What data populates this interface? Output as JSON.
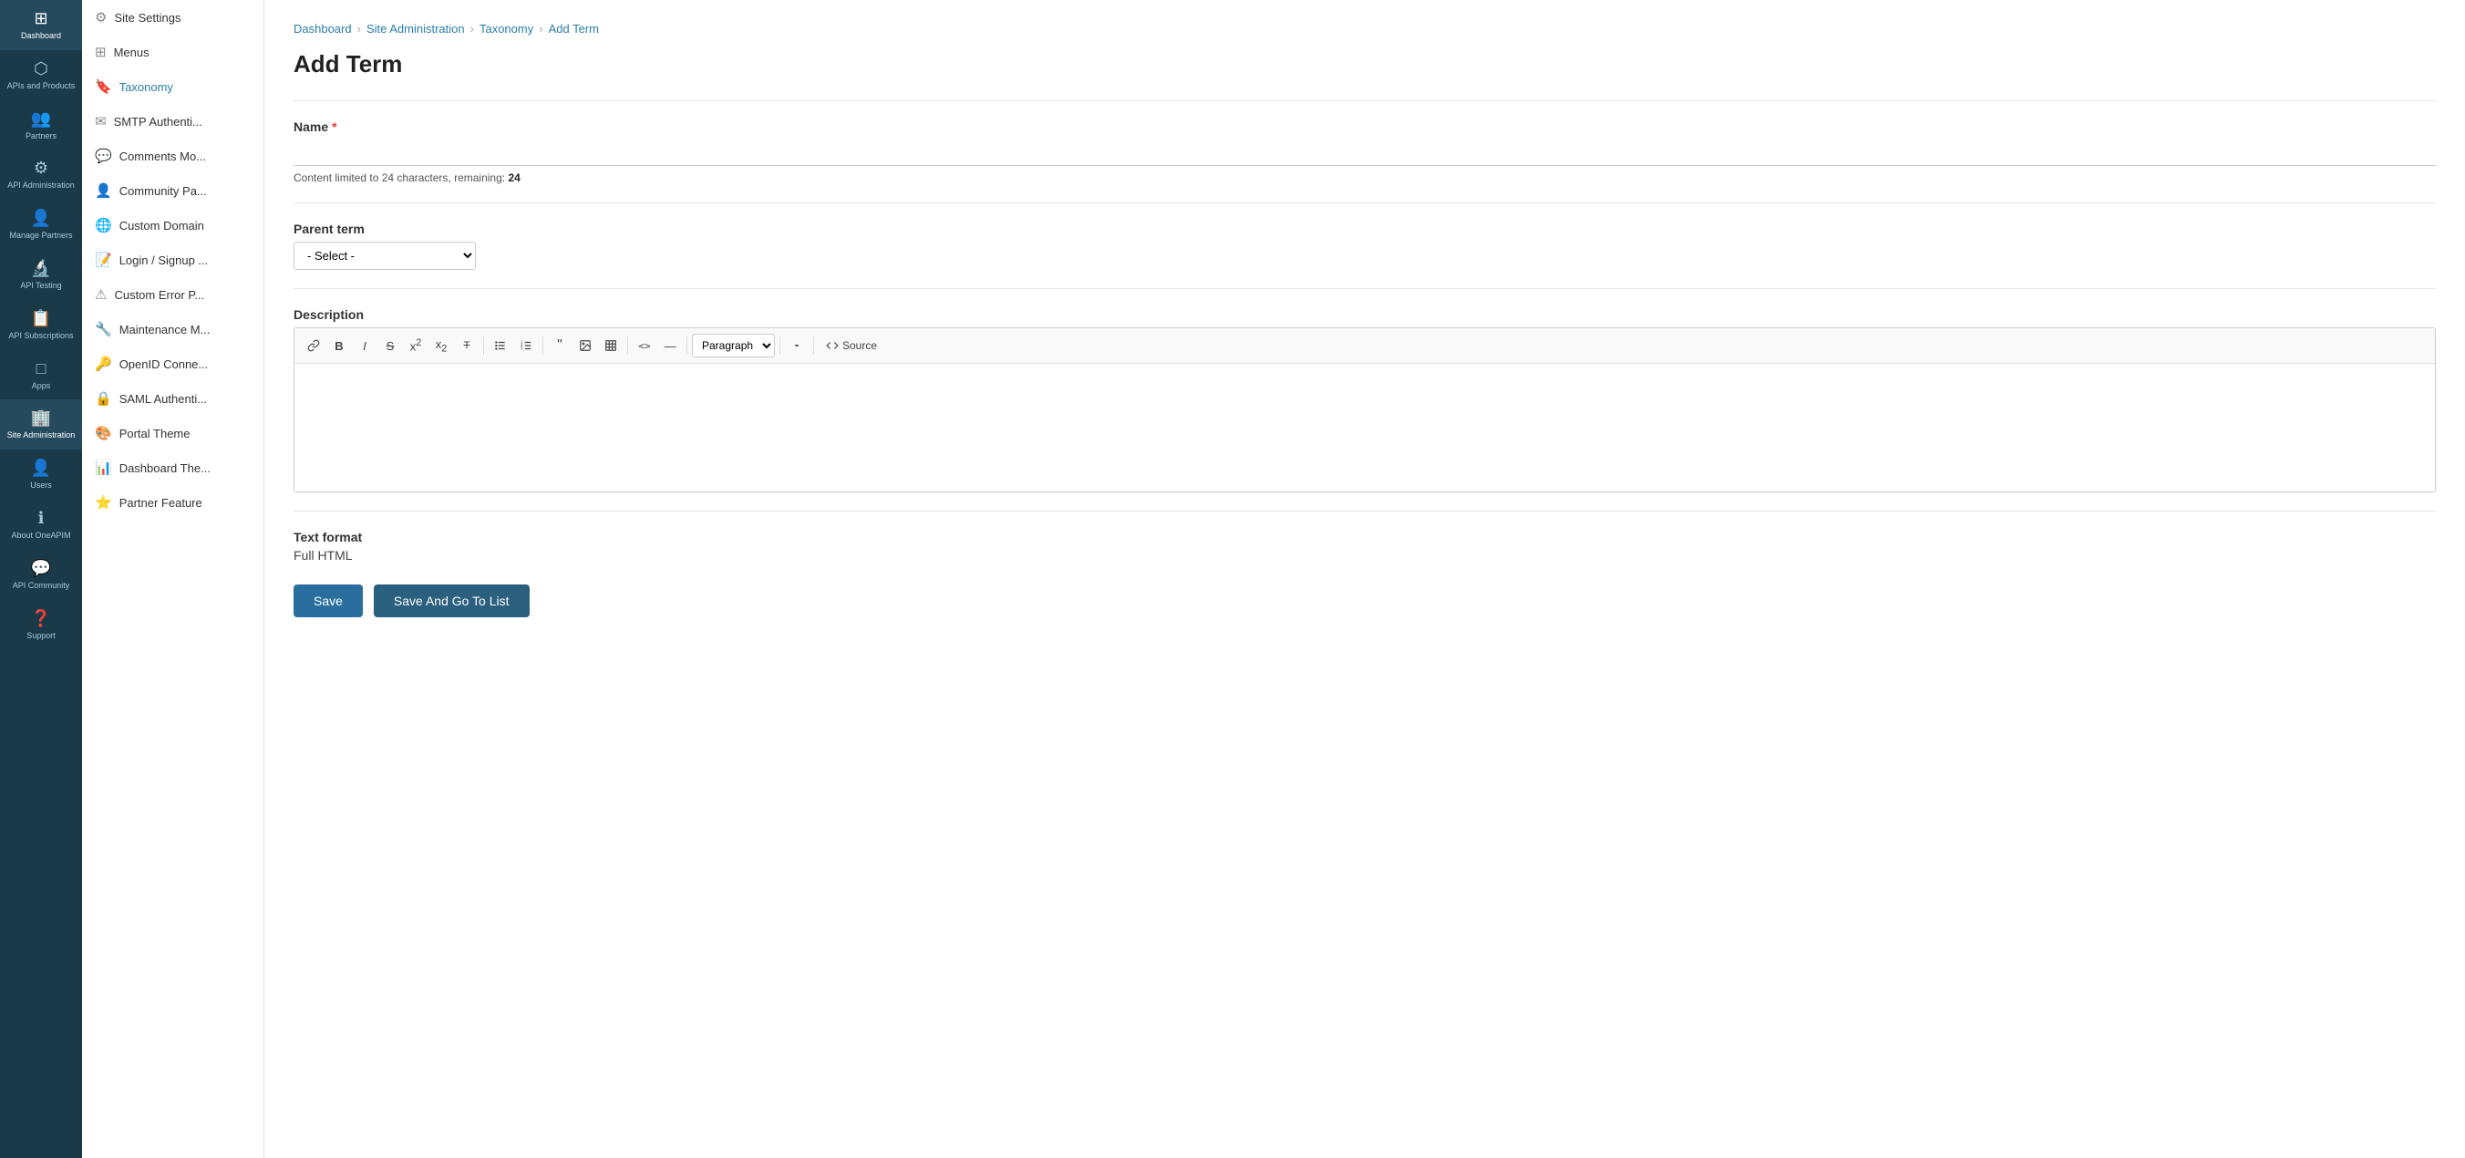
{
  "leftNav": {
    "items": [
      {
        "id": "dashboard",
        "label": "Dashboard",
        "icon": "⊞"
      },
      {
        "id": "apis-products",
        "label": "APIs and Products",
        "icon": "⬡"
      },
      {
        "id": "partners",
        "label": "Partners",
        "icon": "👥"
      },
      {
        "id": "api-administration",
        "label": "API Administration",
        "icon": "⚙"
      },
      {
        "id": "manage-partners",
        "label": "Manage Partners",
        "icon": "👤"
      },
      {
        "id": "api-testing",
        "label": "API Testing",
        "icon": "🔬"
      },
      {
        "id": "api-subscriptions",
        "label": "API Subscriptions",
        "icon": "📋"
      },
      {
        "id": "apps",
        "label": "Apps",
        "icon": "□"
      },
      {
        "id": "site-administration",
        "label": "Site Administration",
        "icon": "🏢",
        "active": true
      },
      {
        "id": "users",
        "label": "Users",
        "icon": "👤"
      },
      {
        "id": "about-oneapim",
        "label": "About OneAPIM",
        "icon": "ℹ"
      },
      {
        "id": "api-community",
        "label": "API Community",
        "icon": "💬"
      },
      {
        "id": "support",
        "label": "Support",
        "icon": "❓"
      }
    ]
  },
  "secondSidebar": {
    "items": [
      {
        "id": "site-settings",
        "label": "Site Settings",
        "icon": "⚙"
      },
      {
        "id": "menus",
        "label": "Menus",
        "icon": "⊞"
      },
      {
        "id": "taxonomy",
        "label": "Taxonomy",
        "icon": "🔖",
        "active": true
      },
      {
        "id": "smtp-auth",
        "label": "SMTP Authenti...",
        "icon": "✉"
      },
      {
        "id": "comments-mo",
        "label": "Comments Mo...",
        "icon": "💬"
      },
      {
        "id": "community-pa",
        "label": "Community Pa...",
        "icon": "👤"
      },
      {
        "id": "custom-domain",
        "label": "Custom Domain",
        "icon": "🌐"
      },
      {
        "id": "login-signup",
        "label": "Login / Signup ...",
        "icon": "📝"
      },
      {
        "id": "custom-error-p",
        "label": "Custom Error P...",
        "icon": "⚠"
      },
      {
        "id": "maintenance-m",
        "label": "Maintenance M...",
        "icon": "🔧"
      },
      {
        "id": "openid-conne",
        "label": "OpenID Conne...",
        "icon": "🔑"
      },
      {
        "id": "saml-authenti",
        "label": "SAML Authenti...",
        "icon": "🔒"
      },
      {
        "id": "portal-theme",
        "label": "Portal Theme",
        "icon": "🎨"
      },
      {
        "id": "dashboard-the",
        "label": "Dashboard The...",
        "icon": "📊"
      },
      {
        "id": "partner-feature",
        "label": "Partner Feature",
        "icon": "⭐"
      }
    ]
  },
  "breadcrumb": {
    "items": [
      {
        "id": "dashboard",
        "label": "Dashboard",
        "link": true
      },
      {
        "id": "site-administration",
        "label": "Site Administration",
        "link": true
      },
      {
        "id": "taxonomy",
        "label": "Taxonomy",
        "link": true
      },
      {
        "id": "add-term",
        "label": "Add Term",
        "link": false,
        "active": true
      }
    ]
  },
  "page": {
    "title": "Add Term"
  },
  "form": {
    "nameLabel": "Name",
    "nameRequired": "*",
    "namePlaceholder": "",
    "charLimitText": "Content limited to 24 characters, remaining:",
    "charRemaining": "24",
    "parentTermLabel": "Parent term",
    "parentTermSelect": "- Select -",
    "descriptionLabel": "Description",
    "textFormatLabel": "Text format",
    "textFormatValue": "Full HTML"
  },
  "toolbar": {
    "buttons": [
      {
        "id": "link",
        "label": "🔗",
        "title": "Link"
      },
      {
        "id": "bold",
        "label": "B",
        "title": "Bold"
      },
      {
        "id": "italic",
        "label": "I",
        "title": "Italic"
      },
      {
        "id": "strikethrough",
        "label": "S",
        "title": "Strikethrough"
      },
      {
        "id": "superscript",
        "label": "x²",
        "title": "Superscript"
      },
      {
        "id": "subscript",
        "label": "x₂",
        "title": "Subscript"
      },
      {
        "id": "clear-format",
        "label": "T",
        "title": "Clear Format"
      },
      {
        "id": "unordered-list",
        "label": "≡",
        "title": "Unordered List"
      },
      {
        "id": "ordered-list",
        "label": "≡↓",
        "title": "Ordered List"
      },
      {
        "id": "blockquote",
        "label": "❝",
        "title": "Blockquote"
      },
      {
        "id": "image",
        "label": "🖼",
        "title": "Image"
      },
      {
        "id": "table",
        "label": "⊞",
        "title": "Table"
      },
      {
        "id": "code",
        "label": "<>",
        "title": "Code"
      },
      {
        "id": "hr",
        "label": "—",
        "title": "Horizontal Rule"
      }
    ],
    "paragraphSelectDefault": "Paragraph",
    "sourceLabel": "Source"
  },
  "actions": {
    "saveLabel": "Save",
    "saveAndGoToListLabel": "Save And Go To List"
  }
}
